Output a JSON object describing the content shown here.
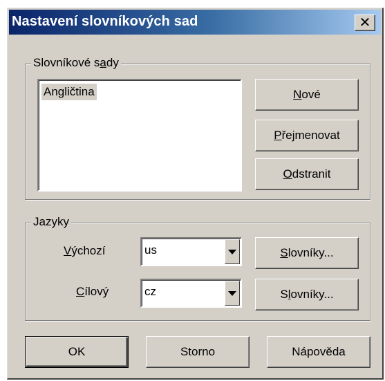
{
  "window": {
    "title": "Nastavení slovníkových sad",
    "close_glyph": "✕"
  },
  "sets_group": {
    "legend_pre": "Slovníkové s",
    "legend_ul": "a",
    "legend_post": "dy",
    "items": [
      "Angličtina"
    ],
    "new_button": {
      "ul": "N",
      "rest": "ové"
    },
    "rename_button": {
      "ul": "P",
      "rest": "řejmenovat"
    },
    "remove_button": {
      "ul": "O",
      "rest": "dstranit"
    }
  },
  "languages_group": {
    "legend": "Jazyky",
    "source": {
      "label_ul": "V",
      "label_rest": "ýchozí",
      "value": "us",
      "dict_ul": "S",
      "dict_rest": "lovníky..."
    },
    "target": {
      "label_ul": "C",
      "label_rest": "ílový",
      "value": "cz",
      "dict_pre": "S",
      "dict_ul": "l",
      "dict_rest": "ovníky..."
    }
  },
  "footer": {
    "ok": "OK",
    "cancel": "Storno",
    "help": "Nápověda"
  }
}
